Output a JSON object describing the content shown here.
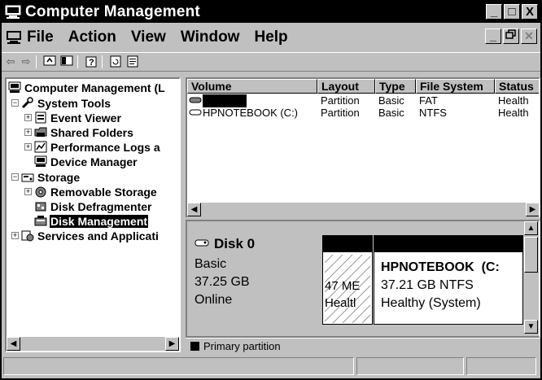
{
  "window": {
    "title": "Computer Management",
    "minimize": "_",
    "restore": "□",
    "close": "X"
  },
  "menubar": {
    "items": [
      "File",
      "Action",
      "View",
      "Window",
      "Help"
    ],
    "mdi_min": "_",
    "mdi_restore": "̅□",
    "mdi_close": "✕"
  },
  "toolbar": {
    "back": "⇦",
    "forward": "⇨"
  },
  "tree": {
    "root": "Computer Management (L",
    "system_tools": "System Tools",
    "event_viewer": "Event Viewer",
    "shared_folders": "Shared Folders",
    "perf_logs": "Performance Logs a",
    "device_manager": "Device Manager",
    "storage": "Storage",
    "removable_storage": "Removable Storage",
    "disk_defrag": "Disk Defragmenter",
    "disk_management": "Disk Management",
    "services": "Services and Applicati"
  },
  "volume_list": {
    "headers": [
      "Volume",
      "Layout",
      "Type",
      "File System",
      "Status"
    ],
    "rows": [
      {
        "volume": "",
        "layout": "Partition",
        "type": "Basic",
        "fs": "FAT",
        "status": "Health"
      },
      {
        "volume": "HPNOTEBOOK (C:)",
        "layout": "Partition",
        "type": "Basic",
        "fs": "NTFS",
        "status": "Health"
      }
    ]
  },
  "disk": {
    "name": "Disk 0",
    "type": "Basic",
    "size": "37.25 GB",
    "status": "Online",
    "small_vol_size": "47 ME",
    "small_vol_status": "Healtl",
    "main_vol_name": "HPNOTEBOOK  (C:",
    "main_vol_size": "37.21 GB NTFS",
    "main_vol_status": "Healthy (System)"
  },
  "legend": {
    "primary_partition": "Primary partition",
    "swatch_color": "#000000"
  }
}
